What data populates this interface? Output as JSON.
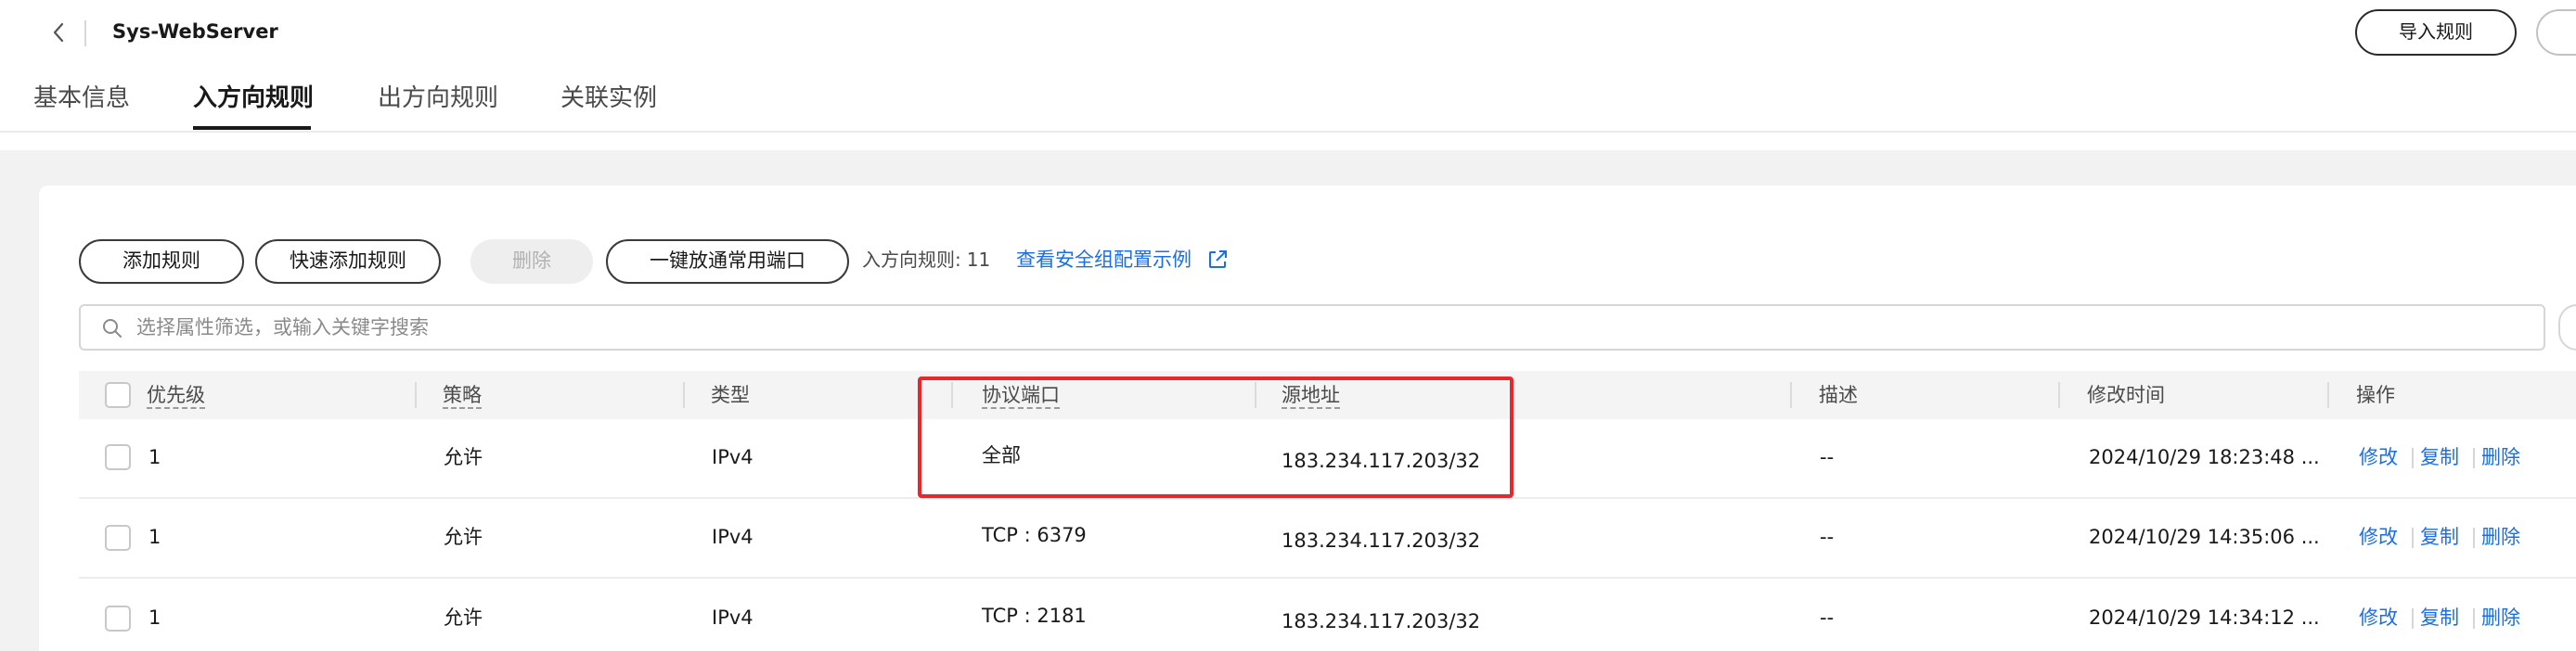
{
  "header": {
    "title": "Sys-WebServer",
    "import_label": "导入规则"
  },
  "tabs": [
    {
      "label": "基本信息"
    },
    {
      "label": "入方向规则"
    },
    {
      "label": "出方向规则"
    },
    {
      "label": "关联实例"
    }
  ],
  "toolbar": {
    "add_label": "添加规则",
    "quick_add_label": "快速添加规则",
    "delete_label": "删除",
    "open_ports_label": "一键放通常用端口",
    "rule_count_label": "入方向规则:",
    "rule_count": "11",
    "example_link": "查看安全组配置示例"
  },
  "search": {
    "placeholder": "选择属性筛选，或输入关键字搜索"
  },
  "table": {
    "columns": [
      "优先级",
      "策略",
      "类型",
      "协议端口",
      "源地址",
      "描述",
      "修改时间",
      "操作"
    ],
    "rows": [
      {
        "priority": "1",
        "policy": "允许",
        "type": "IPv4",
        "protocol_port": "全部",
        "source": "183.234.117.203/32",
        "description": "--",
        "modified": "2024/10/29 18:23:48 ...",
        "actions": [
          "修改",
          "复制",
          "删除"
        ]
      },
      {
        "priority": "1",
        "policy": "允许",
        "type": "IPv4",
        "protocol_port": "TCP : 6379",
        "source": "183.234.117.203/32",
        "description": "--",
        "modified": "2024/10/29 14:35:06 ...",
        "actions": [
          "修改",
          "复制",
          "删除"
        ]
      },
      {
        "priority": "1",
        "policy": "允许",
        "type": "IPv4",
        "protocol_port": "TCP : 2181",
        "source": "183.234.117.203/32",
        "description": "--",
        "modified": "2024/10/29 14:34:12 ...",
        "actions": [
          "修改",
          "复制",
          "删除"
        ]
      }
    ]
  },
  "colors": {
    "link": "#1a6fe8",
    "highlight": "#e8262b"
  }
}
